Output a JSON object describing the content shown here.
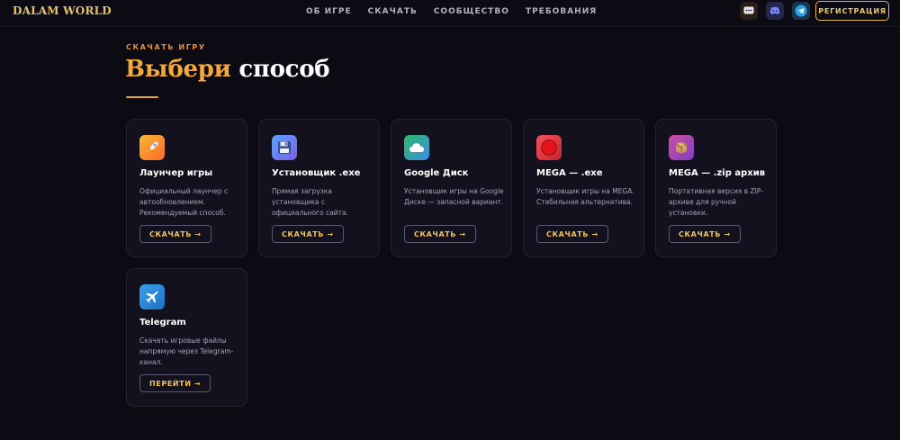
{
  "header": {
    "logo": "DALAM WORLD",
    "nav": [
      "ОБ ИГРЕ",
      "СКАЧАТЬ",
      "СООБЩЕСТВО",
      "ТРЕБОВАНИЯ"
    ],
    "icons": [
      "chat-icon",
      "discord-icon",
      "telegram-icon"
    ],
    "register_label": "РЕГИСТРАЦИЯ"
  },
  "section": {
    "eyebrow": "СКАЧАТЬ ИГРУ",
    "title_accent": "Выбери",
    "title_rest": "способ"
  },
  "cards": [
    {
      "name": "Лаунчер игры",
      "desc": "Официальный лаунчер с автообновлением. Рекомендуемый способ.",
      "button": "СКАЧАТЬ →",
      "icon": "rocket-icon"
    },
    {
      "name": "Установщик .exe",
      "desc": "Прямая загрузка установщика с официального сайта.",
      "button": "СКАЧАТЬ →",
      "icon": "floppy-disk-icon"
    },
    {
      "name": "Google Диск",
      "desc": "Установщик игры на Google Диске — запасной вариант.",
      "button": "СКАЧАТЬ →",
      "icon": "cloud-icon"
    },
    {
      "name": "MEGA — .exe",
      "desc": "Установщик игры на MEGA. Стабильная альтернатива.",
      "button": "СКАЧАТЬ →",
      "icon": "red-circle-icon"
    },
    {
      "name": "MEGA — .zip архив",
      "desc": "Портативная версия в ZIP-архиве для ручной установки.",
      "button": "СКАЧАТЬ →",
      "icon": "package-icon"
    },
    {
      "name": "Telegram",
      "desc": "Скачать игровые файлы напрямую через Telegram-канал.",
      "button": "ПЕРЕЙТИ →",
      "icon": "airplane-icon"
    }
  ],
  "colors": {
    "background": "#0c0b14",
    "accent_gold": "#f0c45a",
    "accent_orange": "#f4a83a",
    "card_bg": "#12111d"
  }
}
